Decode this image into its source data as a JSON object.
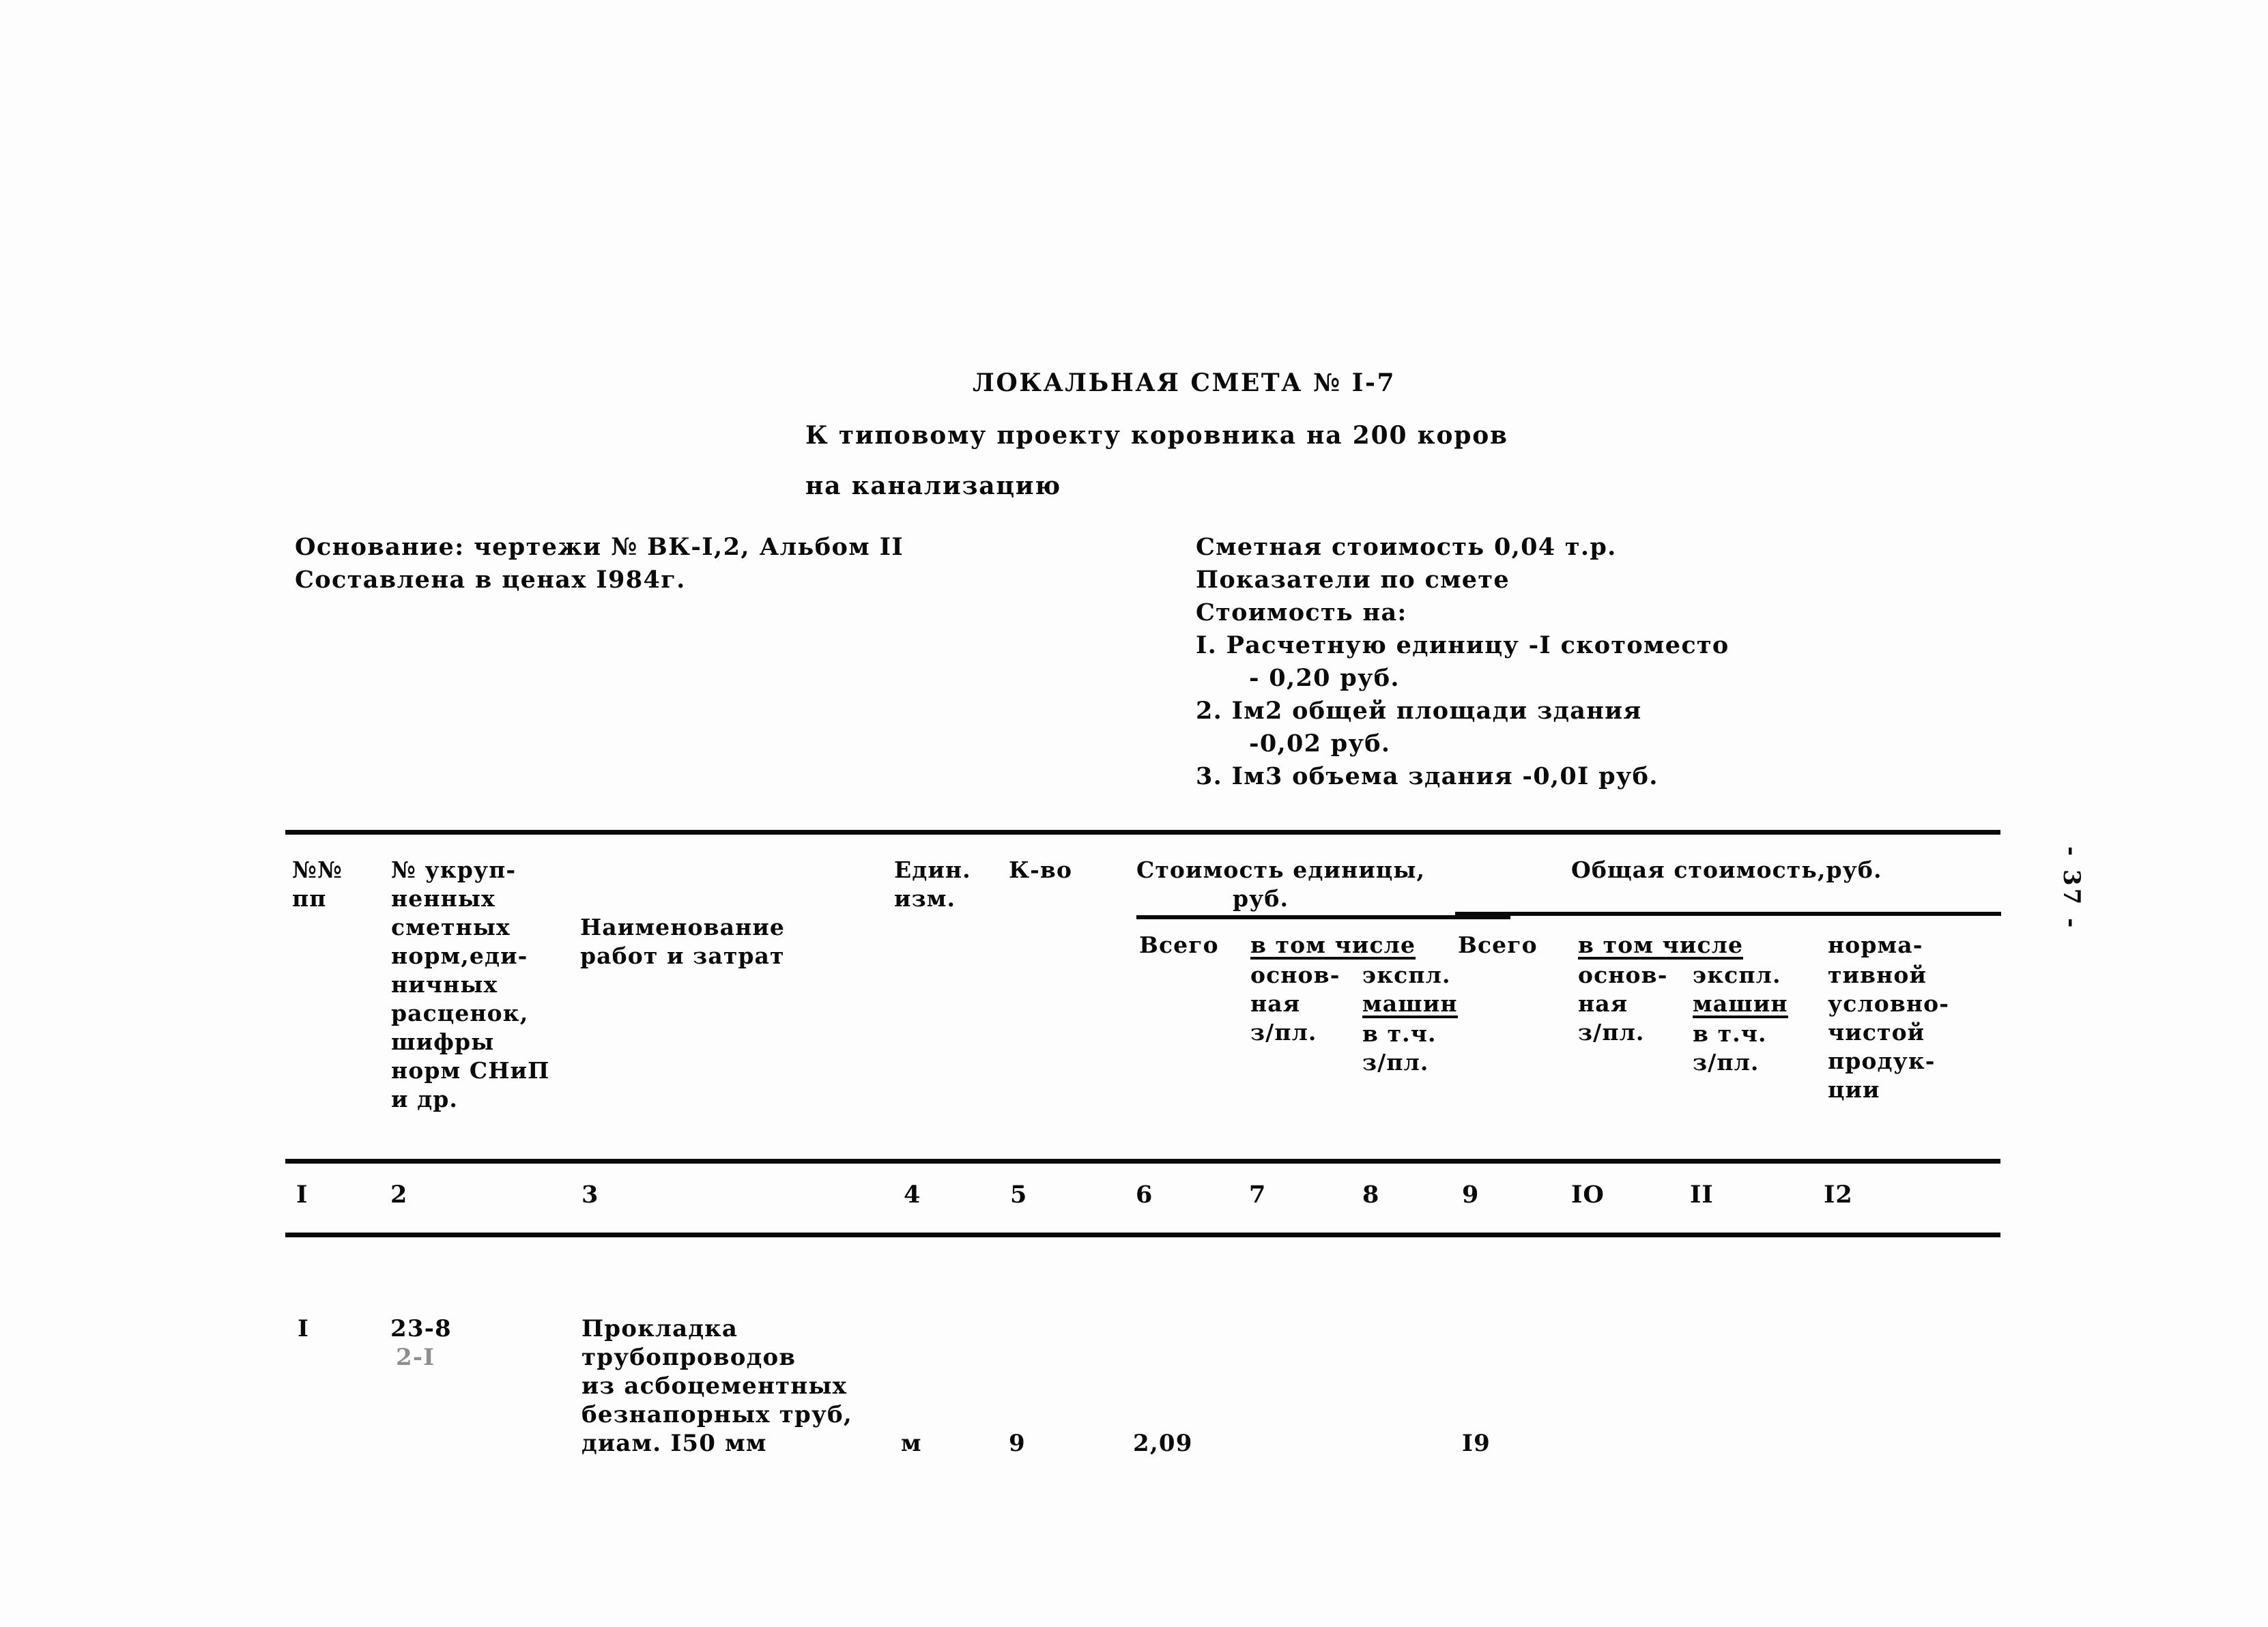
{
  "document": {
    "title_line_1": "ЛОКАЛЬНАЯ СМЕТА № I-7",
    "title_line_2": "К типовому проекту коровника на 200 коров",
    "title_line_3": "на канализацию",
    "page_marker": "- 37 -"
  },
  "meta_left": {
    "line_1": "Основание: чертежи № ВК-I,2, Альбом II",
    "line_2": "Составлена в ценах I984г."
  },
  "meta_right": {
    "estimate_cost": "Сметная стоимость 0,04 т.р.",
    "indicators_heading": "Показатели по смете",
    "cost_per_heading": "Стоимость на:",
    "item_1_line_1": "I. Расчетную единицу -I скотоместо",
    "item_1_line_2": "- 0,20 руб.",
    "item_2_line_1": "2. Iм2 общей площади здания",
    "item_2_line_2": "-0,02 руб.",
    "item_3_line_1": "3. Iм3 объема здания -0,0I руб."
  },
  "table": {
    "headers": {
      "col1": [
        "№№",
        "пп"
      ],
      "col2": [
        "№ укруп-",
        "ненных",
        "сметных",
        "норм,еди-",
        "ничных",
        "расценок,",
        "шифры",
        "норм СНиП",
        "и др."
      ],
      "col3": [
        "Наименование",
        "работ и затрат"
      ],
      "col4": [
        "Един.",
        "изм."
      ],
      "col5": [
        "К-во"
      ],
      "group_unit_cost": [
        "Стоимость единицы,",
        "руб."
      ],
      "group_total_cost": [
        "Общая стоимость,руб."
      ],
      "col6": [
        "Всего"
      ],
      "col7": [
        "в том числе",
        "основ-",
        "ная",
        "з/пл."
      ],
      "col8": [
        "экспл.",
        "машин",
        "в т.ч.",
        "з/пл."
      ],
      "col9": [
        "Всего"
      ],
      "col10": [
        "в том числе",
        "основ-",
        "ная",
        "з/пл."
      ],
      "col11": [
        "экспл.",
        "машин",
        "в т.ч.",
        "з/пл."
      ],
      "col12": [
        "норма-",
        "тивной",
        "условно-",
        "чистой",
        "продук-",
        "ции"
      ]
    },
    "column_numbers": [
      "I",
      "2",
      "3",
      "4",
      "5",
      "6",
      "7",
      "8",
      "9",
      "IO",
      "II",
      "I2"
    ],
    "rows": [
      {
        "num": "I",
        "code_line_1": "23-8",
        "code_line_2": "2-I",
        "name_line_1": "Прокладка",
        "name_line_2": "трубопроводов",
        "name_line_3": "из асбоцементных",
        "name_line_4": "безнапорных труб,",
        "name_line_5": "диам. I50 мм",
        "unit": "м",
        "qty": "9",
        "unit_total": "2,09",
        "unit_main_salary": "",
        "unit_machines": "",
        "grand_total": "I9",
        "total_main_salary": "",
        "total_machines": "",
        "normative_product": ""
      }
    ]
  },
  "colors": {
    "ink": "#0a0a0a",
    "paper": "#fdfdfd"
  }
}
